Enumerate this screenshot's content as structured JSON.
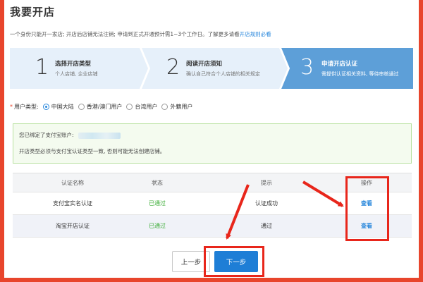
{
  "page": {
    "title": "我要开店",
    "notice_text": "一个身份只能开一家店; 开店后店铺无法注销; 申请到正式开通预计需1~3个工作日。了解更多请看",
    "notice_link": "开店规则必看"
  },
  "steps": [
    {
      "number": "1",
      "title": "选择开店类型",
      "desc": "个人店铺, 企业店铺",
      "active": false
    },
    {
      "number": "2",
      "title": "阅读开店须知",
      "desc": "确认自己符合个人店铺的相关规定",
      "active": false
    },
    {
      "number": "3",
      "title": "申请开店认证",
      "desc": "需提供认证相关资料, 等待审核通过",
      "active": true
    }
  ],
  "user_type": {
    "required_mark": "*",
    "label": "用户类型:",
    "options": [
      "中国大陆",
      "香港/澳门用户",
      "台湾用户",
      "外籍用户"
    ],
    "selected": "中国大陆"
  },
  "info_box": {
    "line1": "您已绑定了支付宝账户:",
    "line2": "开店类型必须与支付宝认证类型一致, 否则可能无法创建店铺。"
  },
  "table": {
    "headers": [
      "认证名称",
      "状态",
      "提示",
      "操作"
    ],
    "rows": [
      {
        "name": "支付宝实名认证",
        "status": "已通过",
        "hint": "认证成功",
        "action": "查看"
      },
      {
        "name": "淘宝开店认证",
        "status": "已通过",
        "hint": "通过",
        "action": "查看"
      }
    ]
  },
  "buttons": {
    "prev": "上一步",
    "next": "下一步"
  },
  "colors": {
    "accent": "#1e7ed6",
    "active_step": "#5d9fd8",
    "inactive_step": "#e6f0fa",
    "success": "#3fae3a",
    "annotation_red": "#e8261b"
  }
}
